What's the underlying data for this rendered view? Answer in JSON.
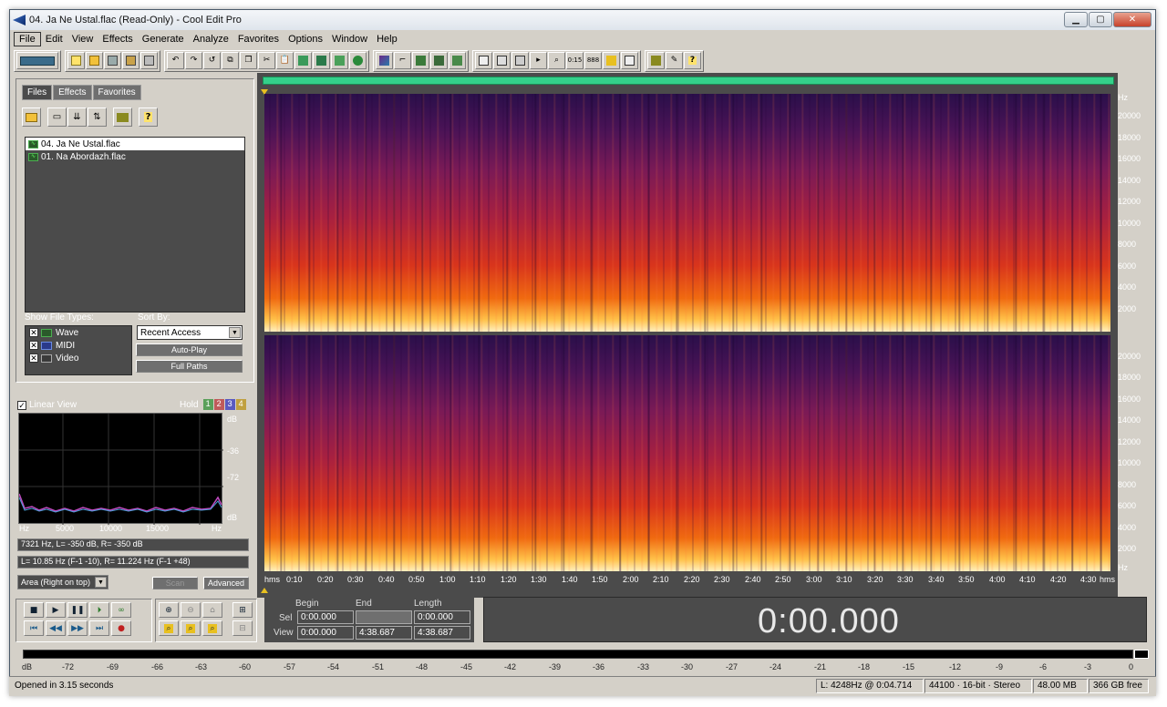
{
  "window": {
    "title": "04. Ja Ne Ustal.flac (Read-Only) - Cool Edit Pro",
    "btn_min": "▁",
    "btn_max": "▢",
    "btn_close": "✕"
  },
  "menu": [
    "File",
    "Edit",
    "View",
    "Effects",
    "Generate",
    "Analyze",
    "Favorites",
    "Options",
    "Window",
    "Help"
  ],
  "file_panel": {
    "tabs": [
      "Files",
      "Effects",
      "Favorites"
    ],
    "files": [
      "04. Ja Ne Ustal.flac",
      "01. Na Abordazh.flac"
    ],
    "show_types_label": "Show File Types:",
    "types": [
      "Wave",
      "MIDI",
      "Video"
    ],
    "sort_label": "Sort By:",
    "sort_value": "Recent Access",
    "auto_play": "Auto-Play",
    "full_paths": "Full Paths"
  },
  "freq_panel": {
    "linear_view": "Linear View",
    "hold": "Hold",
    "hold_slots": [
      "1",
      "2",
      "3",
      "4"
    ],
    "db_labels": [
      "dB",
      "-36",
      "-72",
      "dB"
    ],
    "x_labels": [
      "Hz",
      "5000",
      "10000",
      "15000",
      "Hz"
    ],
    "readout1": "7321 Hz, L= -350 dB, R= -350 dB",
    "readout2": "L= 10.85 Hz (F-1 -10), R= 11.224 Hz (F-1 +48)",
    "mode": "Area (Right on top)",
    "scan": "Scan",
    "advanced": "Advanced"
  },
  "spectrogram": {
    "hz_unit": "Hz",
    "hz_ticks": [
      "20000",
      "18000",
      "16000",
      "14000",
      "12000",
      "10000",
      "8000",
      "6000",
      "4000",
      "2000"
    ],
    "time_unit": "hms",
    "time_ticks": [
      "0:10",
      "0:20",
      "0:30",
      "0:40",
      "0:50",
      "1:00",
      "1:10",
      "1:20",
      "1:30",
      "1:40",
      "1:50",
      "2:00",
      "2:10",
      "2:20",
      "2:30",
      "2:40",
      "2:50",
      "3:00",
      "3:10",
      "3:20",
      "3:30",
      "3:40",
      "3:50",
      "4:00",
      "4:10",
      "4:20",
      "4:30"
    ]
  },
  "selection": {
    "begin_label": "Begin",
    "end_label": "End",
    "length_label": "Length",
    "sel_label": "Sel",
    "view_label": "View",
    "sel_begin": "0:00.000",
    "sel_end": "",
    "sel_length": "0:00.000",
    "view_begin": "0:00.000",
    "view_end": "4:38.687",
    "view_length": "4:38.687"
  },
  "time_display": "0:00.000",
  "meter": {
    "ticks": [
      "dB",
      "-72",
      "-69",
      "-66",
      "-63",
      "-60",
      "-57",
      "-54",
      "-51",
      "-48",
      "-45",
      "-42",
      "-39",
      "-36",
      "-33",
      "-30",
      "-27",
      "-24",
      "-21",
      "-18",
      "-15",
      "-12",
      "-9",
      "-6",
      "-3",
      "0"
    ]
  },
  "status": {
    "message": "Opened in 3.15 seconds",
    "cursor": "L: 4248Hz @  0:04.714",
    "format": "44100 · 16-bit · Stereo",
    "size": "48.00 MB",
    "free": "366 GB free"
  }
}
